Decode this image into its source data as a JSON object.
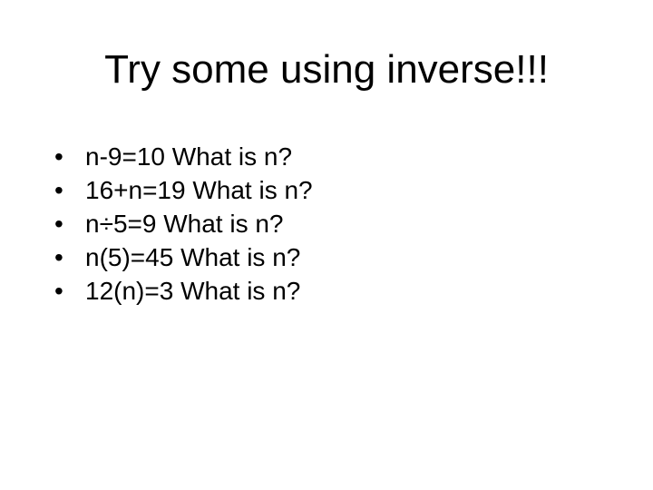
{
  "title": "Try some using inverse!!!",
  "bullets": [
    "n-9=10  What is n?",
    "16+n=19  What is n?",
    "n÷5=9  What is n?",
    "n(5)=45 What is n?",
    "12(n)=3 What is n?"
  ],
  "bullet_char": "•"
}
